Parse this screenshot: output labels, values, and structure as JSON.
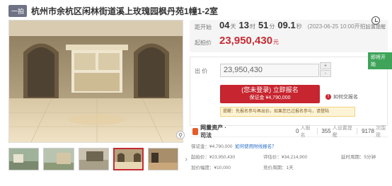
{
  "header": {
    "badge": "一拍",
    "title": "杭州市余杭区闲林街道溪上玫瑰园枫丹苑1幢1-2室"
  },
  "countdown": {
    "label": "距开始",
    "days": "04",
    "days_unit": "天",
    "hours": "13",
    "hours_unit": "时",
    "minutes": "51",
    "minutes_unit": "分",
    "seconds": "09.1",
    "seconds_unit": "秒",
    "note": "(2023-06-25 10:00开拍)"
  },
  "start_price": {
    "label": "起拍价",
    "value": "23,950,430",
    "unit": "元"
  },
  "remind": {
    "label": "设置提醒"
  },
  "bid": {
    "tag": "即将开始",
    "label": "出 价",
    "value": "23,950,430",
    "plus": "+",
    "minus": "-",
    "signup_line1": "(您未登录) 立即报名",
    "signup_line2": "保证金 ¥4,790,000",
    "howto": "如何交报名",
    "notice": "提醒：先报名参与再出价。如果您已过报名参与，请登陆"
  },
  "provider": {
    "name": "网量资产 · 司法",
    "bids_num": "0",
    "bids_label": "人报名",
    "reminds_num": "355",
    "reminds_label": "人设置提醒",
    "views_num": "9178",
    "views_label": "次围观"
  },
  "info": {
    "deposit_label": "保证金：",
    "deposit_value": "¥4,790,000",
    "deposit_link": "如何使用附线报名？",
    "start_label": "起拍价：",
    "start_value": "¥23,950,430",
    "assess_label": "评估价：",
    "assess_value": "¥34,214,900",
    "delay_label": "延时周期：",
    "delay_value": "5分钟",
    "increment_label": "加价幅度：",
    "increment_value": "¥10,000",
    "cycle_label": "竞价周期：",
    "cycle_value": "1天"
  },
  "zoom_icon": "magnifier-icon",
  "colors": {
    "accent_red": "#c7252f",
    "tag_green": "#3fa45a",
    "link_blue": "#2a6fc9"
  }
}
